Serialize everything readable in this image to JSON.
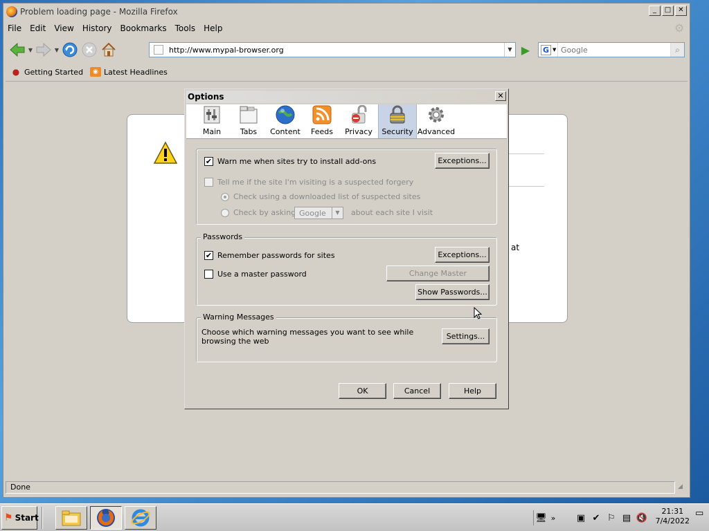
{
  "window": {
    "title": "Problem loading page - Mozilla Firefox",
    "minimize": "_",
    "maximize": "□",
    "close": "✕"
  },
  "menu": [
    "File",
    "Edit",
    "View",
    "History",
    "Bookmarks",
    "Tools",
    "Help"
  ],
  "navigation": {
    "url": "http://www.mypal-browser.org",
    "search_placeholder": "Google",
    "search_engine_letter": "G"
  },
  "bookmarks": [
    {
      "label": "Getting Started",
      "icon": "firefox-icon"
    },
    {
      "label": "Latest Headlines",
      "icon": "rss-icon"
    }
  ],
  "error_page": {
    "visible_fragment": "at"
  },
  "status": "Done",
  "options_dialog": {
    "title": "Options",
    "tabs": [
      {
        "label": "Main",
        "icon": "main-pane-icon"
      },
      {
        "label": "Tabs",
        "icon": "tabs-pane-icon"
      },
      {
        "label": "Content",
        "icon": "content-pane-icon"
      },
      {
        "label": "Feeds",
        "icon": "feeds-pane-icon"
      },
      {
        "label": "Privacy",
        "icon": "privacy-pane-icon"
      },
      {
        "label": "Security",
        "icon": "security-pane-icon",
        "active": true
      },
      {
        "label": "Advanced",
        "icon": "advanced-pane-icon"
      }
    ],
    "addons": {
      "warn_label": "Warn me when sites try to install add-ons",
      "warn_checked": true,
      "exceptions_label": "Exceptions...",
      "forgery_label": "Tell me if the site I'm visiting is a suspected forgery",
      "forgery_checked": false,
      "check_downloaded_label": "Check using a downloaded list of suspected sites",
      "check_asking_label": "Check by asking",
      "provider_value": "Google",
      "about_each_site_label": "about each site I visit"
    },
    "passwords": {
      "legend": "Passwords",
      "remember_label": "Remember passwords for sites",
      "remember_checked": true,
      "exceptions_label": "Exceptions...",
      "master_label": "Use a master password",
      "master_checked": false,
      "change_master_label": "Change Master Password...",
      "show_passwords_label": "Show Passwords..."
    },
    "warnings": {
      "legend": "Warning Messages",
      "description": "Choose which warning messages you want to see while browsing the web",
      "settings_label": "Settings..."
    },
    "buttons": {
      "ok": "OK",
      "cancel": "Cancel",
      "help": "Help"
    }
  },
  "taskbar": {
    "start_label": "Start",
    "time": "21:31",
    "date": "7/4/2022",
    "tray_expand": "»"
  }
}
